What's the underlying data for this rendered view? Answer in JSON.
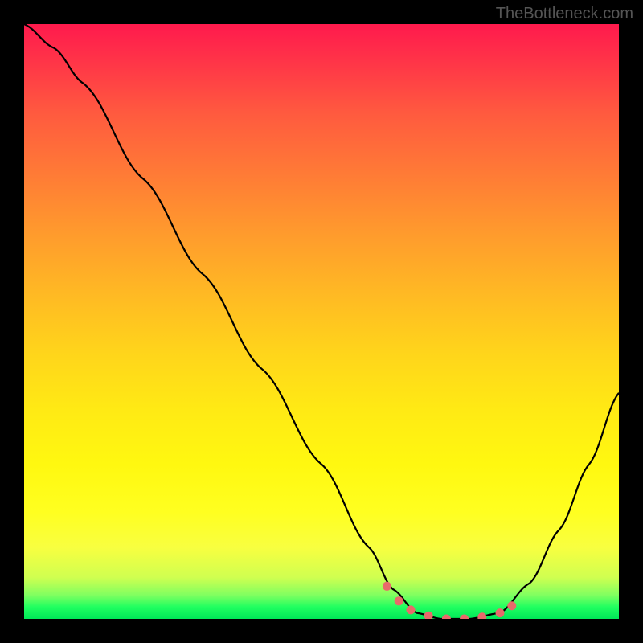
{
  "watermark": "TheBottleneck.com",
  "chart_data": {
    "type": "line",
    "title": "",
    "xlabel": "",
    "ylabel": "",
    "x_range": [
      0,
      100
    ],
    "y_range": [
      0,
      100
    ],
    "series": [
      {
        "name": "curve",
        "color": "#000000",
        "points": [
          {
            "x": 0,
            "y": 100
          },
          {
            "x": 5,
            "y": 96
          },
          {
            "x": 10,
            "y": 90
          },
          {
            "x": 20,
            "y": 74
          },
          {
            "x": 30,
            "y": 58
          },
          {
            "x": 40,
            "y": 42
          },
          {
            "x": 50,
            "y": 26
          },
          {
            "x": 58,
            "y": 12
          },
          {
            "x": 62,
            "y": 5
          },
          {
            "x": 66,
            "y": 1
          },
          {
            "x": 70,
            "y": 0
          },
          {
            "x": 75,
            "y": 0
          },
          {
            "x": 80,
            "y": 1
          },
          {
            "x": 85,
            "y": 6
          },
          {
            "x": 90,
            "y": 15
          },
          {
            "x": 95,
            "y": 26
          },
          {
            "x": 100,
            "y": 38
          }
        ]
      },
      {
        "name": "highlight-dots",
        "color": "#e86a6a",
        "points": [
          {
            "x": 61,
            "y": 5.5
          },
          {
            "x": 63,
            "y": 3
          },
          {
            "x": 65,
            "y": 1.5
          },
          {
            "x": 68,
            "y": 0.5
          },
          {
            "x": 71,
            "y": 0
          },
          {
            "x": 74,
            "y": 0
          },
          {
            "x": 77,
            "y": 0.3
          },
          {
            "x": 80,
            "y": 1
          },
          {
            "x": 82,
            "y": 2.2
          }
        ]
      }
    ],
    "gradient_colors": {
      "top": "#ff1a4d",
      "mid_upper": "#ff9a2d",
      "mid": "#ffea14",
      "mid_lower": "#f8ff40",
      "bottom": "#00e858"
    }
  }
}
